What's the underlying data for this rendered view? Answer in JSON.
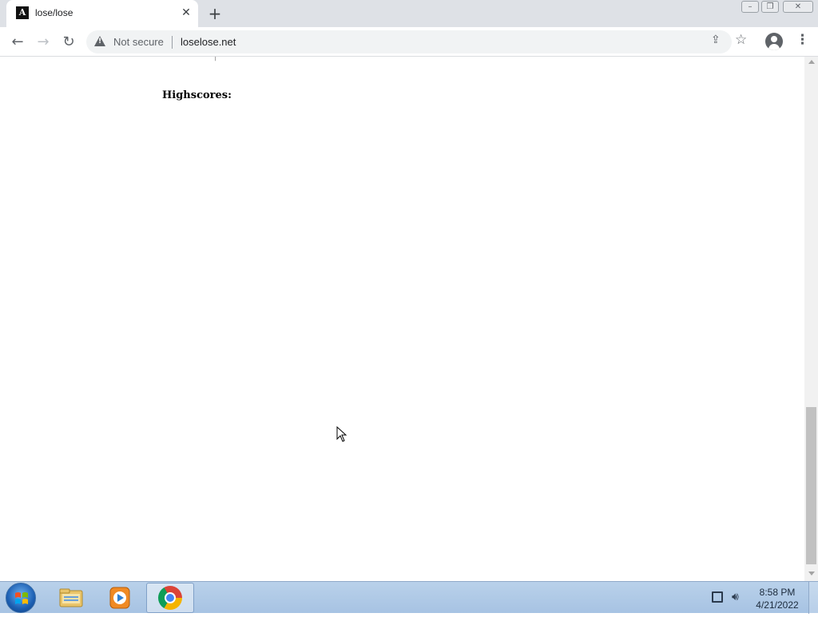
{
  "browser": {
    "tab": {
      "title": "lose/lose",
      "favicon": "lose-lose-favicon"
    },
    "address_bar": {
      "security_label": "Not secure",
      "url": "loselose.net"
    }
  },
  "page": {
    "partial_text": "|",
    "heading": "Highscores:"
  },
  "taskbar": {
    "clock": {
      "time": "8:58 PM",
      "date": "4/21/2022"
    },
    "pinned": [
      "windows-explorer",
      "windows-media-player",
      "google-chrome"
    ]
  },
  "colors": {
    "tabstrip_bg": "#dee1e6",
    "taskbar_bg": "#b9d1ea",
    "text_dark": "#202124",
    "text_muted": "#5f6368"
  }
}
